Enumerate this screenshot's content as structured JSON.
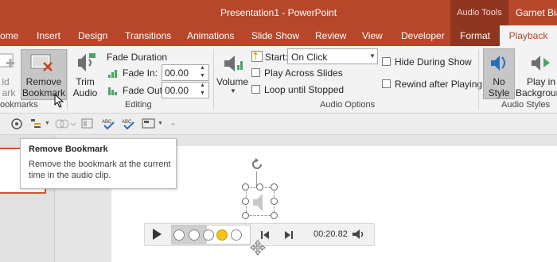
{
  "window": {
    "title": "Presentation1  -  PowerPoint",
    "context_header": "Audio Tools",
    "user_name": "Garnet Bian"
  },
  "tabs": [
    {
      "label": "ome"
    },
    {
      "label": "Insert"
    },
    {
      "label": "Design"
    },
    {
      "label": "Transitions"
    },
    {
      "label": "Animations"
    },
    {
      "label": "Slide Show"
    },
    {
      "label": "Review"
    },
    {
      "label": "View"
    },
    {
      "label": "Developer"
    },
    {
      "label": "Format"
    },
    {
      "label": "Playback",
      "active": true
    }
  ],
  "ribbon": {
    "bookmarks": {
      "add_label_1": "ld",
      "add_label_2": "ark",
      "remove_label_1": "Remove",
      "remove_label_2": "Bookmark",
      "group_label": "ookmarks"
    },
    "editing": {
      "trim_label_1": "Trim",
      "trim_label_2": "Audio",
      "fade_title": "Fade Duration",
      "fade_in_label": "Fade In:",
      "fade_in_value": "00.00",
      "fade_out_label": "Fade Out:",
      "fade_out_value": "00.00",
      "group_label": "Editing"
    },
    "audio_options": {
      "volume_label": "Volume",
      "start_label": "Start:",
      "start_value": "On Click",
      "play_across_slides": "Play Across Slides",
      "loop_until_stopped": "Loop until Stopped",
      "hide_during_show": "Hide During Show",
      "rewind_after_playing": "Rewind after Playing",
      "group_label": "Audio Options"
    },
    "audio_styles": {
      "no_style_1": "No",
      "no_style_2": "Style",
      "play_bg_1": "Play in",
      "play_bg_2": "Backgroun",
      "group_label": "Audio Styles"
    }
  },
  "tooltip": {
    "title": "Remove Bookmark",
    "description": "Remove the bookmark at the current time in the audio clip."
  },
  "player": {
    "time": "00:20.82",
    "progress": 0.45,
    "bookmarks": 4,
    "active_bookmark": 4
  },
  "colors": {
    "accent": "#b7472a",
    "bookmark_active": "#f5c21b"
  }
}
